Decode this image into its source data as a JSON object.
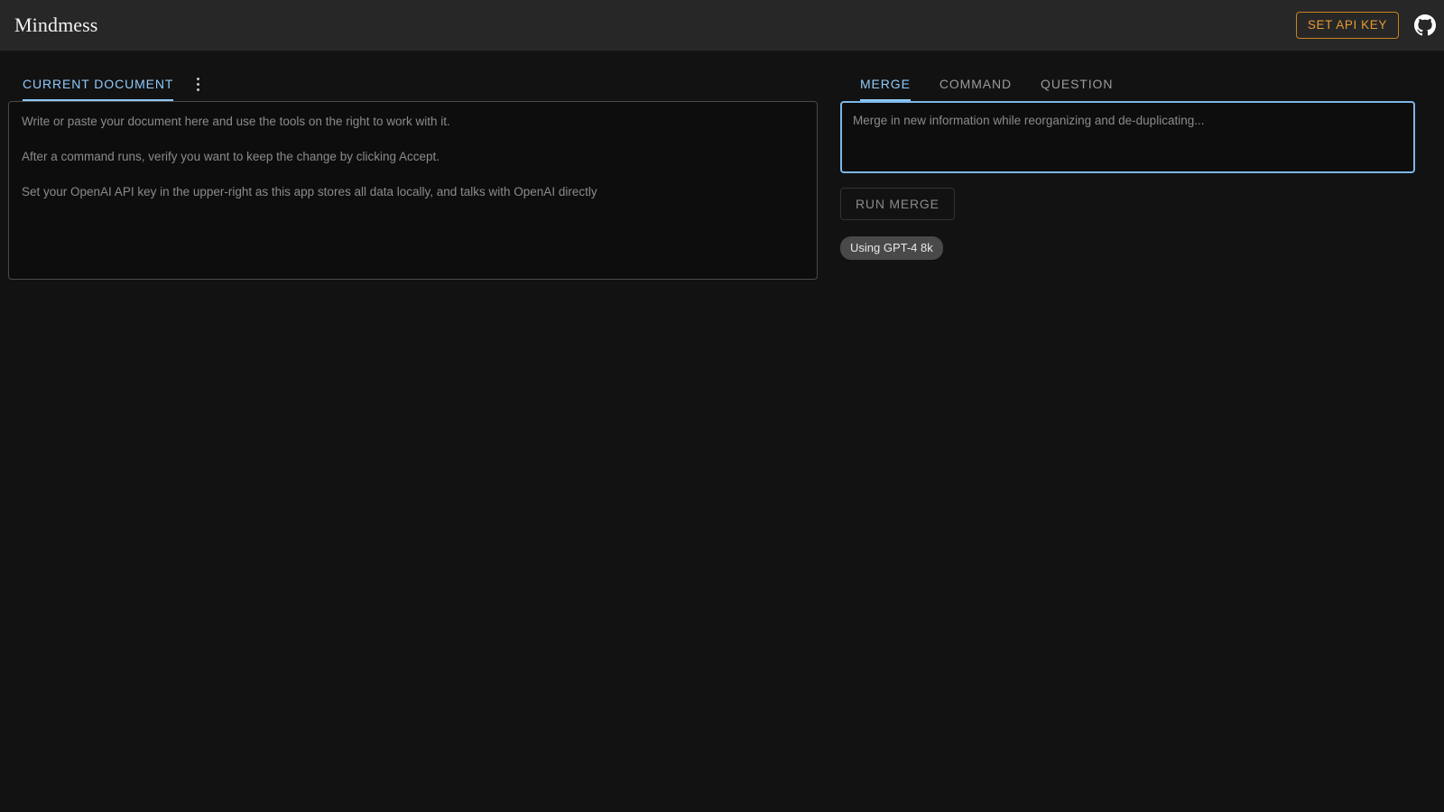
{
  "header": {
    "title": "Mindmess",
    "api_key_button": "SET API KEY",
    "github_icon": "github-icon",
    "background_color": "#272727",
    "accent_color": "#e59a33"
  },
  "left_panel": {
    "tabs": [
      {
        "label": "CURRENT DOCUMENT",
        "active": true
      }
    ],
    "menu_icon": "kebab-menu-icon",
    "document": {
      "value": "",
      "placeholder": "Write or paste your document here and use the tools on the right to work with it.\n\nAfter a command runs, verify you want to keep the change by clicking Accept.\n\nSet your OpenAI API key in the upper-right as this app stores all data locally, and talks with OpenAI directly"
    }
  },
  "right_panel": {
    "tabs": [
      {
        "label": "MERGE",
        "active": true
      },
      {
        "label": "COMMAND",
        "active": false
      },
      {
        "label": "QUESTION",
        "active": false
      }
    ],
    "merge_input": {
      "value": "",
      "placeholder": "Merge in new information while reorganizing and de-duplicating..."
    },
    "run_button": "RUN MERGE",
    "model_chip": "Using GPT-4 8k",
    "active_tab_color": "#90caf9",
    "focus_border_color": "#7ab6e8"
  }
}
